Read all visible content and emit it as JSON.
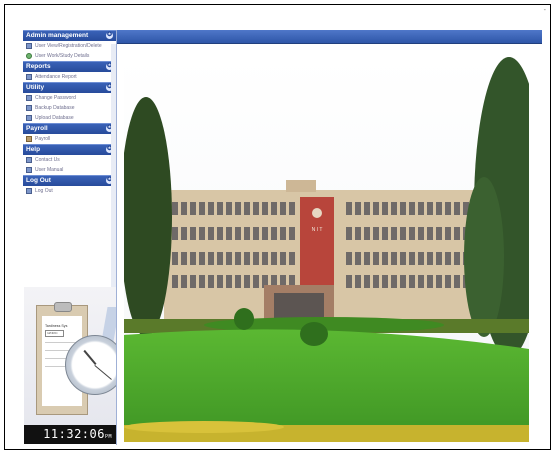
{
  "corner_mark": "-",
  "sidebar": {
    "sections": [
      {
        "title": "Admin management",
        "items": [
          {
            "label": "User View/Registration/Delete",
            "icon": "document-icon"
          },
          {
            "label": "User Work/Study Details",
            "icon": "globe-icon"
          }
        ]
      },
      {
        "title": "Reports",
        "items": [
          {
            "label": "Attendance Report",
            "icon": "report-icon"
          }
        ]
      },
      {
        "title": "Utility",
        "items": [
          {
            "label": "Change Password",
            "icon": "document-icon"
          },
          {
            "label": "Backup Database",
            "icon": "document-icon"
          },
          {
            "label": "Upload Database",
            "icon": "document-icon"
          }
        ]
      },
      {
        "title": "Payroll",
        "items": [
          {
            "label": "Payroll",
            "icon": "payroll-icon"
          }
        ]
      },
      {
        "title": "Help",
        "items": [
          {
            "label": "Contact Us",
            "icon": "document-icon"
          },
          {
            "label": "User Manual",
            "icon": "document-icon"
          }
        ]
      },
      {
        "title": "Log Out",
        "items": [
          {
            "label": "Log Out",
            "icon": "document-icon"
          }
        ]
      }
    ],
    "toggle_symbol": "✪"
  },
  "illustration": {
    "paper_title": "Tardiness Sys",
    "paper_field": "Id/NRIC"
  },
  "clock_time": "11:32:06",
  "clock_suffix": "PM",
  "photo": {
    "building_sign": "N I T"
  },
  "colors": {
    "header_blue": "#2e56a8",
    "section_blue": "#274b9b",
    "lawn_green": "#4aa82c",
    "building_beige": "#d9c7a8",
    "building_red": "#b8453b"
  }
}
